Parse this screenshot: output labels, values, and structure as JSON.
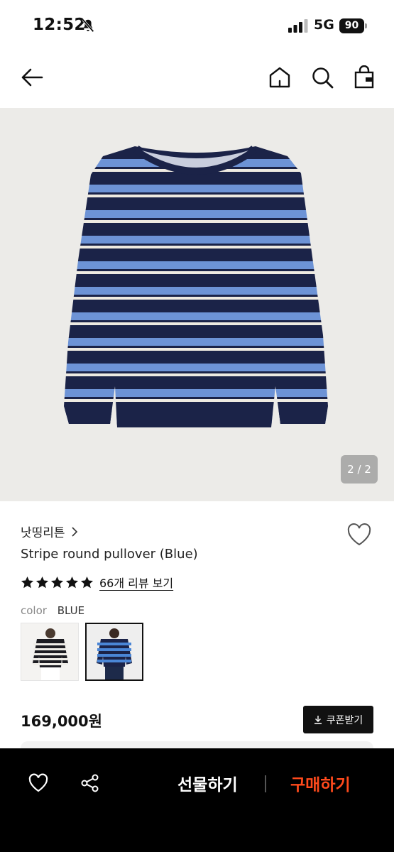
{
  "status_bar": {
    "time": "12:52",
    "network": "5G",
    "battery": "90"
  },
  "header": {
    "icons": [
      "back-arrow-icon",
      "home-icon",
      "search-icon",
      "shopping-bag-icon"
    ]
  },
  "gallery": {
    "counter": "2 / 2"
  },
  "product": {
    "brand": "낫띵리튼",
    "name": "Stripe round pullover (Blue)",
    "rating": 5,
    "review_link": "66개 리뷰 보기",
    "color_label": "color",
    "color_value": "BLUE",
    "price": "169,000원",
    "coupon_label": "쿠폰받기"
  },
  "bottom_bar": {
    "gift_label": "선물하기",
    "buy_label": "구매하기",
    "buy_color": "#ff4a1c"
  },
  "colors": {
    "navy": "#1b2348",
    "light_blue": "#6d93d6",
    "cream": "#eeeae1"
  }
}
